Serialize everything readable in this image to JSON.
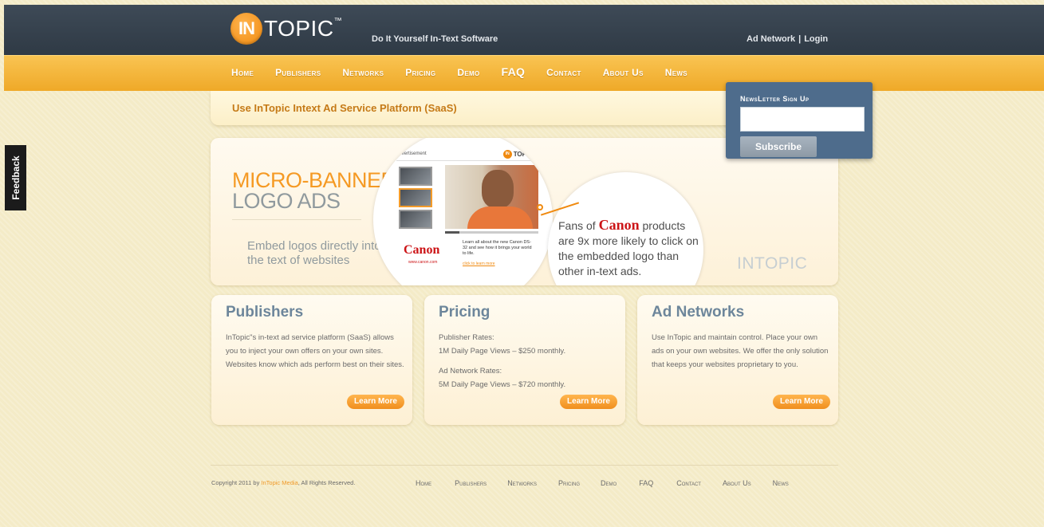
{
  "header": {
    "logo_badge": "IN",
    "logo_word": "TOPIC",
    "logo_tm": "™",
    "tagline": "Do It Yourself In-Text Software",
    "links": [
      "Ad Network",
      "Login"
    ],
    "link_separator": "|"
  },
  "nav": {
    "items": [
      "Home",
      "Publishers",
      "Networks",
      "Pricing",
      "Demo",
      "FAQ",
      "Contact",
      "About Us",
      "News"
    ]
  },
  "headline": "Use InTopic Intext Ad Service Platform (SaaS)",
  "newsletter": {
    "title": "NewsLetter Sign Up",
    "email_value": "",
    "button": "Subscribe"
  },
  "hero": {
    "title_line1": "MICRO-BANNER",
    "title_tm": "™",
    "title_line2": "LOGO ADS",
    "description": "Embed logos directly into the text of websites",
    "ad": {
      "label": "advertisement",
      "mini_logo": "TOPIC",
      "mini_badge": "IN",
      "canon_logo": "Canon",
      "canon_url": "www.canon.com",
      "copy": "Learn all about the new Canon DS-32 and see how it brings your world to life.",
      "cta": "click to learn more"
    },
    "bubble": {
      "prefix": "Fans of",
      "brand": "Canon",
      "suffix": "products are 9x more likely to click on the embedded logo than other in-text ads."
    },
    "brand_mark": "INTOPIC"
  },
  "cards": [
    {
      "title": "Publishers",
      "lines": [
        "InTopic\"s in-text ad service platform (SaaS) allows you to inject your own offers on your own sites. Websites know which ads perform best on their sites."
      ],
      "button": "Learn More"
    },
    {
      "title": "Pricing",
      "lines": [
        "Publisher Rates:",
        "1M Daily Page Views – $250 monthly.",
        "Ad Network Rates:",
        "5M Daily Page Views – $720 monthly."
      ],
      "button": "Learn More"
    },
    {
      "title": "Ad Networks",
      "lines": [
        "Use InTopic and maintain control. Place your own ads on your own websites. We offer the only solution that keeps your websites proprietary to you."
      ],
      "button": "Learn More"
    }
  ],
  "footer": {
    "copyright_pre": "Copyright 2011 by",
    "copyright_media": "InTopic Media",
    "copyright_post": ", All Rights Reserved.",
    "nav": [
      "Home",
      "Publishers",
      "Networks",
      "Pricing",
      "Demo",
      "FAQ",
      "Contact",
      "About Us",
      "News"
    ]
  },
  "feedback_tab": "Feedback",
  "colors": {
    "topbar": "#2f3a45",
    "nav_orange": "#f2ad2c",
    "accent_orange": "#f08f1e",
    "card_title_blue": "#6d869b",
    "newsletter_blue": "#4e6c8c",
    "page_bg": "#f4ebc7"
  }
}
